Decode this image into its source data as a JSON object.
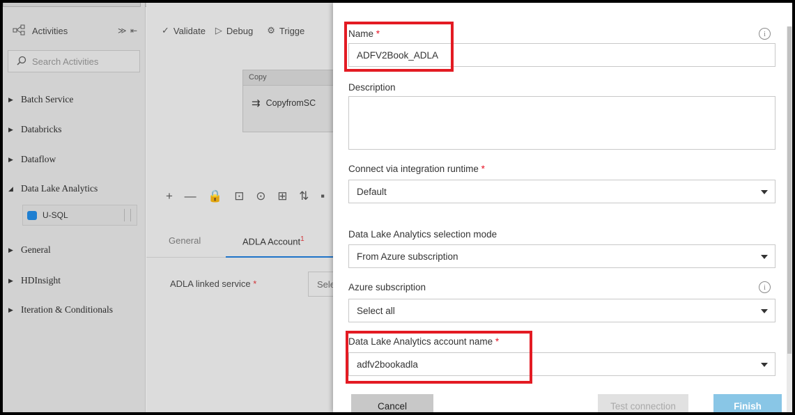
{
  "left_panel": {
    "title": "Activities",
    "collapse_label": "≫ ⇤",
    "search_placeholder": "Search Activities",
    "categories": [
      {
        "label": "Batch Service",
        "expanded": false
      },
      {
        "label": "Databricks",
        "expanded": false
      },
      {
        "label": "Dataflow",
        "expanded": false
      },
      {
        "label": "Data Lake Analytics",
        "expanded": true
      },
      {
        "label": "General",
        "expanded": false
      },
      {
        "label": "HDInsight",
        "expanded": false
      },
      {
        "label": "Iteration & Conditionals",
        "expanded": false
      }
    ],
    "usql_item": "U-SQL"
  },
  "canvas": {
    "toolbar": {
      "validate": "Validate",
      "debug": "Debug",
      "trigger": "Trigge"
    },
    "copy_activity": {
      "header": "Copy",
      "name": "CopyfromSC"
    },
    "zoom_tools": "+ — 🔒 ⊡ ⊙ ⊞ ⇅ ▪",
    "tabs": {
      "general": "General",
      "adla_account": "ADLA Account",
      "adla_badge": "1"
    },
    "linked_service_label": "ADLA linked service",
    "linked_service_value": "Sele"
  },
  "dialog": {
    "name": {
      "label": "Name",
      "value": "ADFV2Book_ADLA"
    },
    "description": {
      "label": "Description",
      "value": ""
    },
    "runtime": {
      "label": "Connect via integration runtime",
      "value": "Default"
    },
    "selection_mode": {
      "label": "Data Lake Analytics selection mode",
      "value": "From Azure subscription"
    },
    "subscription": {
      "label": "Azure subscription",
      "value": "Select all"
    },
    "account_name": {
      "label": "Data Lake Analytics account name",
      "value": "adfv2bookadla"
    },
    "required_mark": "*",
    "info_glyph": "i",
    "buttons": {
      "cancel": "Cancel",
      "test": "Test connection",
      "finish": "Finish"
    }
  },
  "colors": {
    "highlight": "#e31b23",
    "accent": "#1e73c8",
    "finish": "#89c6e6",
    "required": "#e81123"
  }
}
